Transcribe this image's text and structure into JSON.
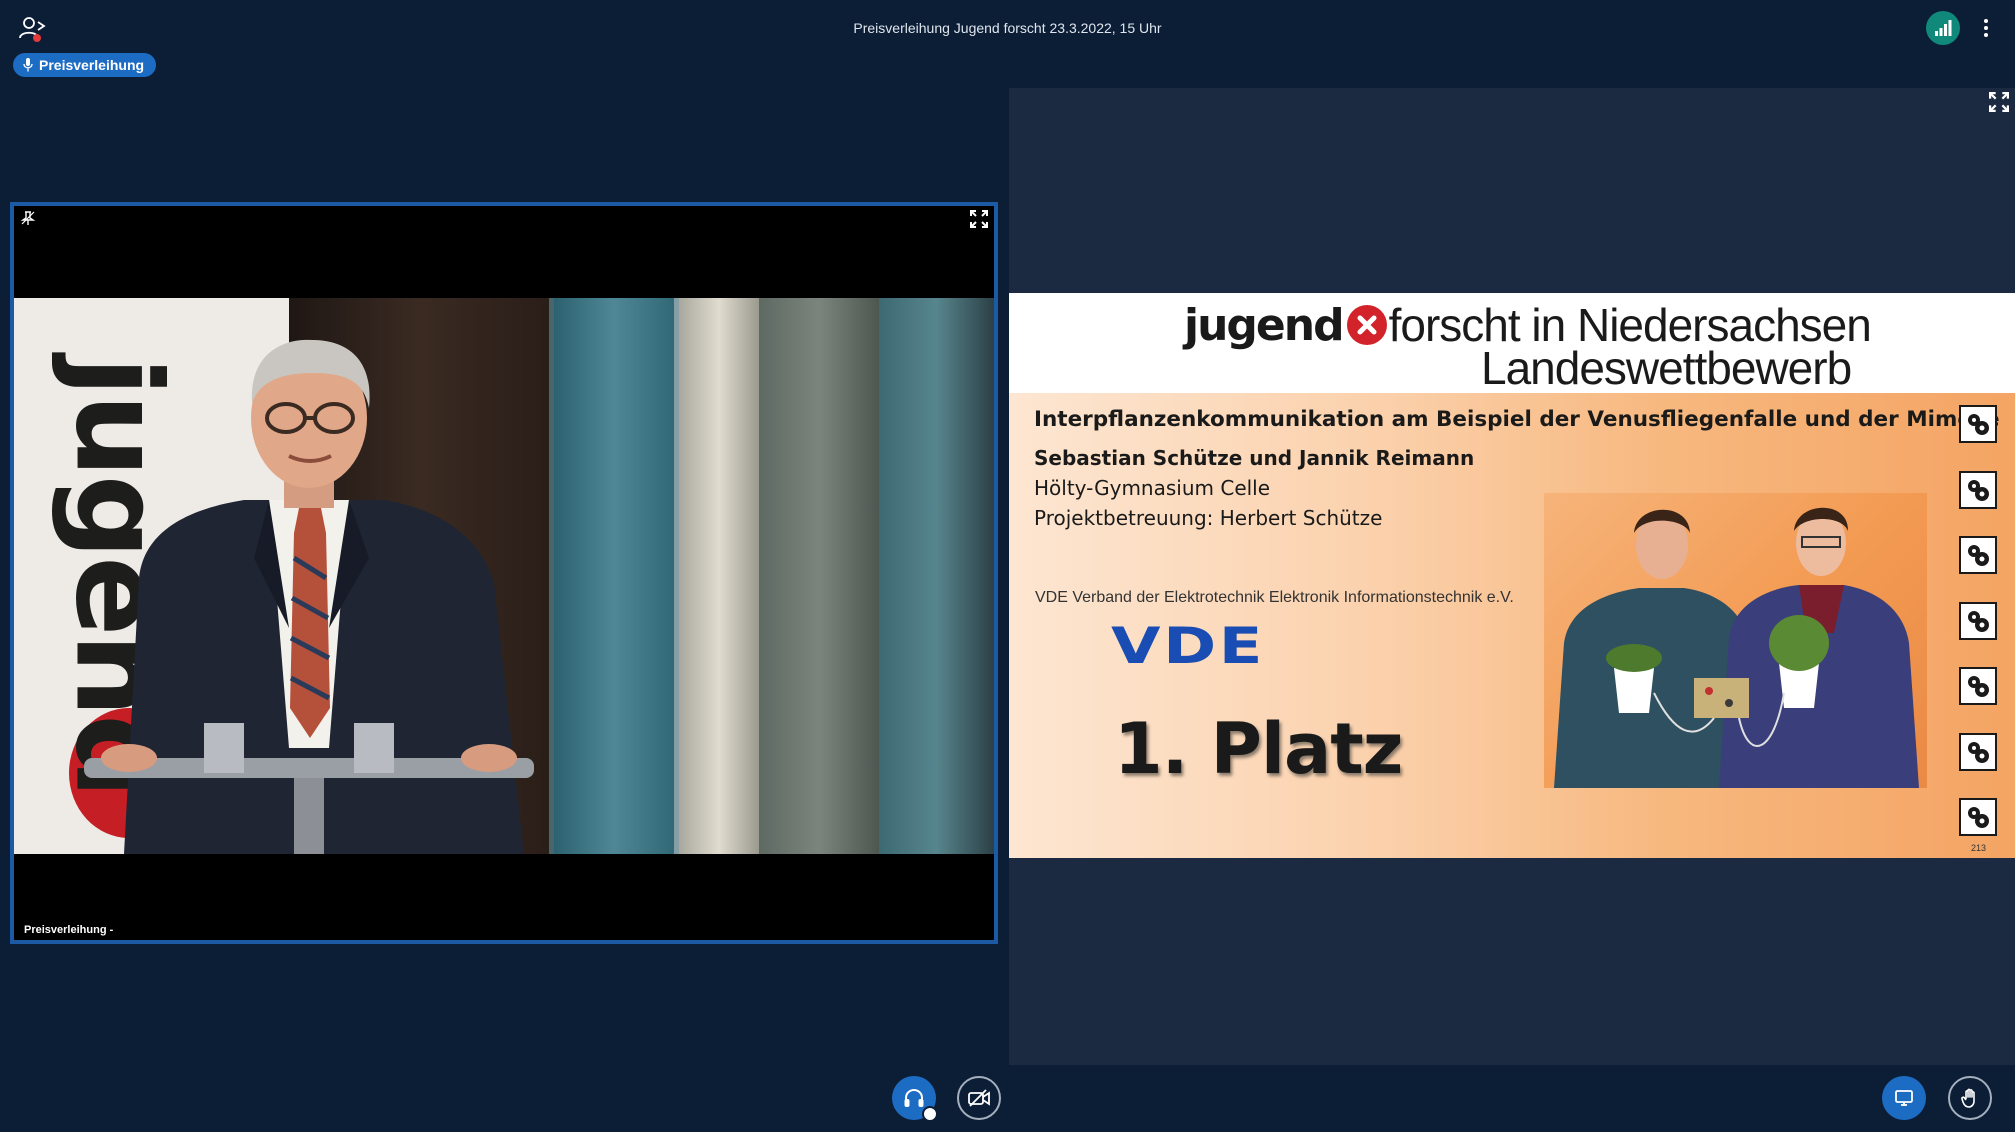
{
  "meeting": {
    "title": "Preisverleihung Jugend forscht 23.3.2022, 15 Uhr"
  },
  "badge": {
    "label": "Preisverleihung",
    "icon": "microphone-icon"
  },
  "webcam": {
    "name_label": "Preisverleihung -",
    "banner_text": "jugend"
  },
  "slide": {
    "logo_word": "jugend",
    "logo_rest": "forscht in Niedersachsen",
    "subtitle": "Landeswettbewerb",
    "project_title": "Interpflanzenkommunikation am Beispiel der Venusfliegenfalle und der Mimose",
    "authors": "Sebastian Schütze und Jannik Reimann",
    "school": "Hölty-Gymnasium Celle",
    "supervision": "Projektbetreuung: Herbert Schütze",
    "sponsor": "VDE Verband der Elektrotechnik Elektronik Informationstechnik e.V.",
    "sponsor_logo": "VDE",
    "prize": "1. Platz",
    "page_number": "213",
    "side_icons": [
      "gear-icon",
      "gear-icon",
      "gear-icon",
      "gear-icon",
      "gear-icon",
      "gear-icon",
      "gear-icon"
    ]
  },
  "controls": {
    "audio": "headphones-icon",
    "video": "camera-off-icon",
    "screenshare": "screen-share-icon",
    "raise_hand": "hand-icon"
  },
  "colors": {
    "background": "#0c1d36",
    "accent": "#1d6cc4",
    "connection": "#11897a",
    "tile_border": "#1d5aa6"
  }
}
